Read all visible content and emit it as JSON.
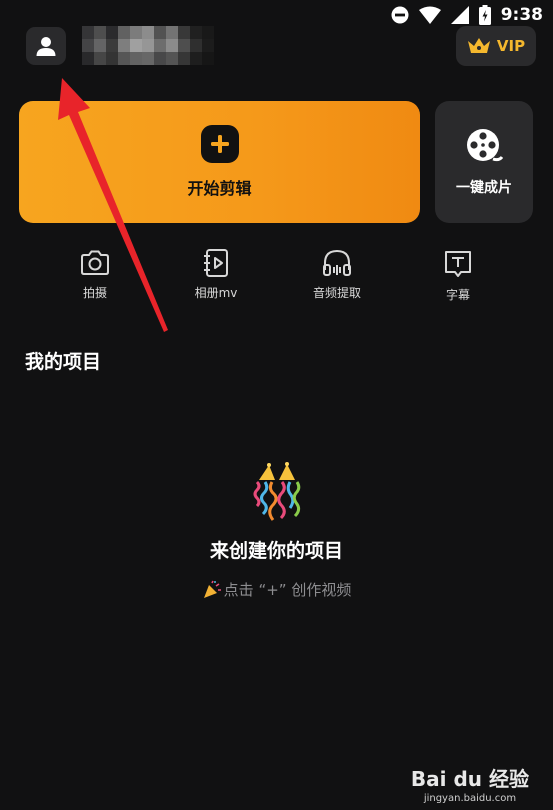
{
  "status_bar": {
    "time": "9:38",
    "icons": [
      "dnd-icon",
      "wifi-icon",
      "signal-icon",
      "battery-icon"
    ]
  },
  "header": {
    "avatar_icon": "user-icon",
    "vip": {
      "label": "VIP",
      "icon": "crown-icon",
      "color": "#f5b82e"
    }
  },
  "main_actions": {
    "start_edit": {
      "label": "开始剪辑",
      "icon": "plus-icon",
      "color": "#f7a51f"
    },
    "one_click": {
      "label": "一键成片",
      "icon": "film-reel-icon"
    }
  },
  "tools": [
    {
      "label": "拍摄",
      "icon": "camera-icon"
    },
    {
      "label": "相册mv",
      "icon": "album-mv-icon"
    },
    {
      "label": "音频提取",
      "icon": "headphones-icon"
    },
    {
      "label": "字幕",
      "icon": "subtitle-icon"
    }
  ],
  "projects": {
    "title": "我的项目",
    "empty_title": "来创建你的项目",
    "empty_hint": "点击 “+” 创作视频",
    "empty_icon": "party-popper-icon"
  },
  "annotation": {
    "color": "#e8242a"
  },
  "watermark": {
    "main": "Bai du 经验",
    "sub": "jingyan.baidu.com"
  }
}
